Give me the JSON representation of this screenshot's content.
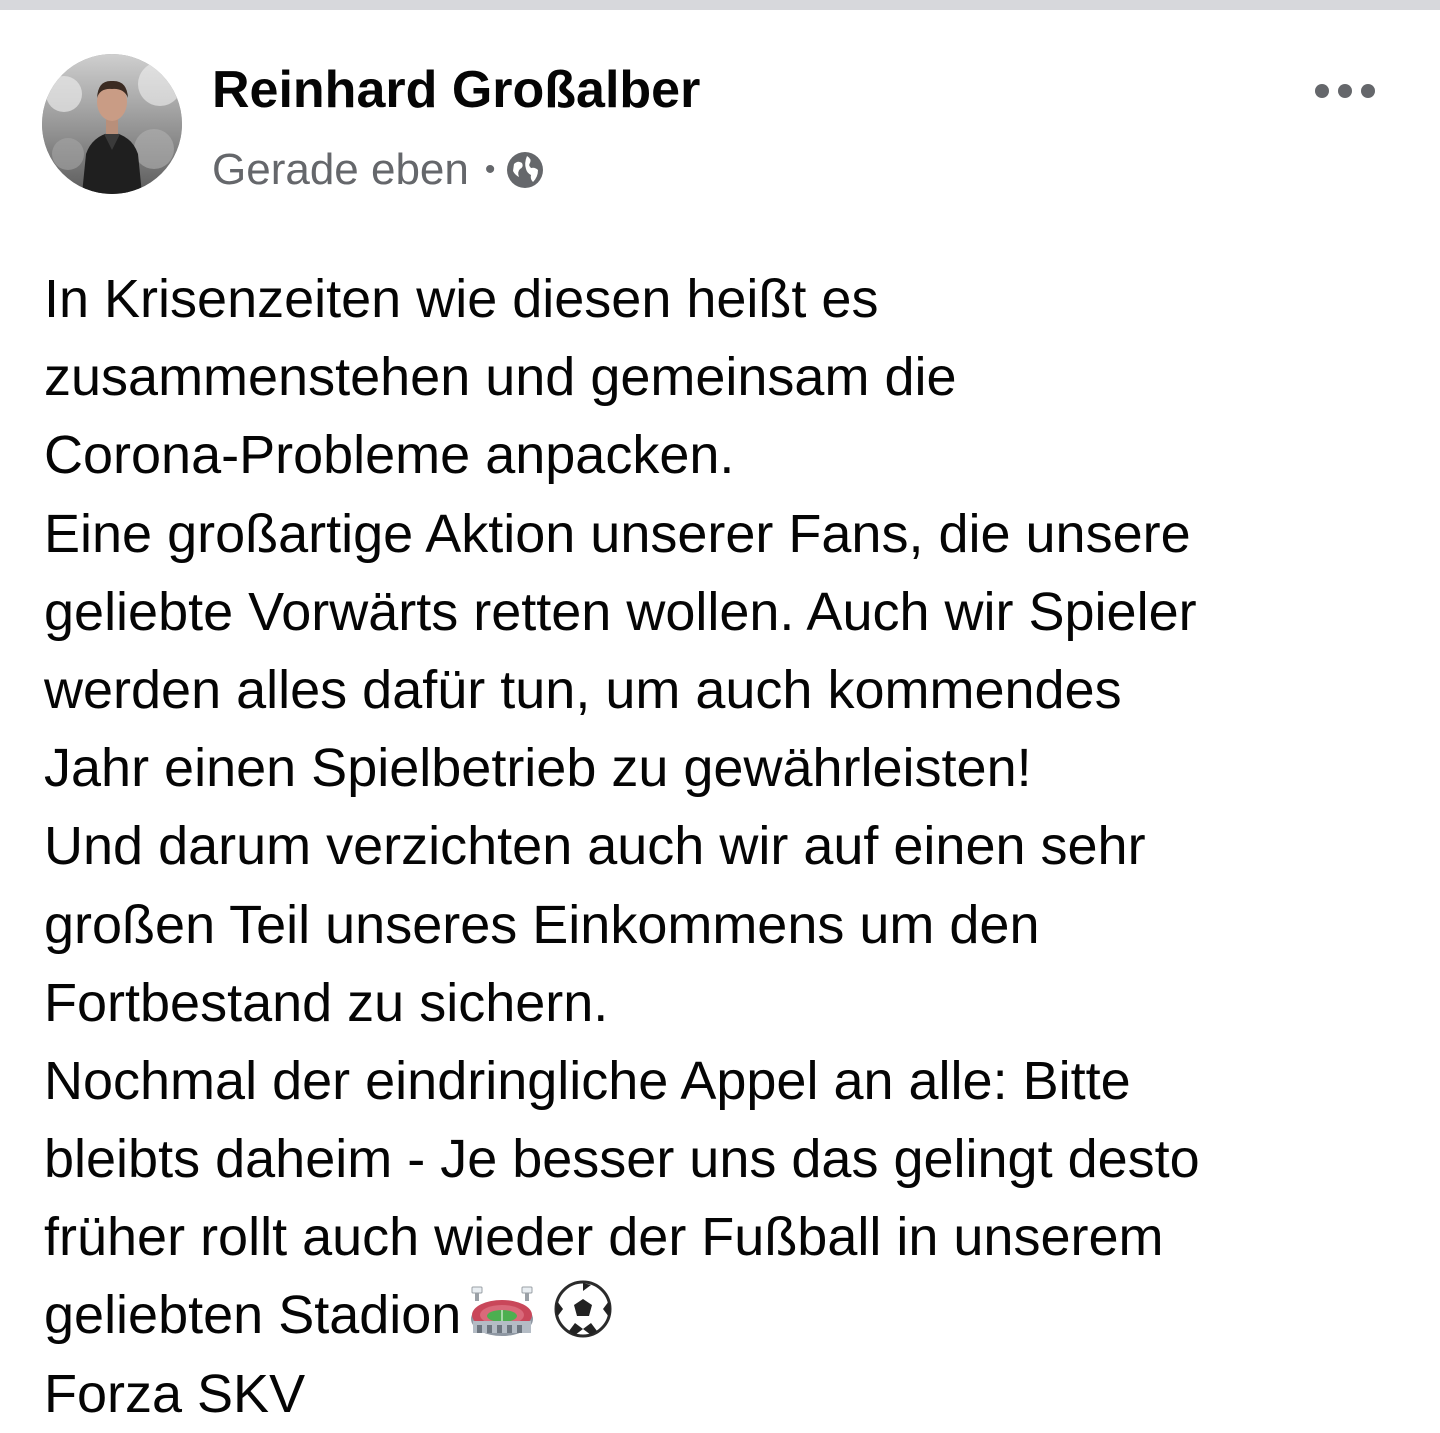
{
  "post": {
    "author": "Reinhard Großalber",
    "timestamp": "Gerade eben",
    "separator": "•",
    "privacy_icon": "globe-icon",
    "more_icon": "more-options-icon",
    "lines": [
      "In Krisenzeiten wie diesen heißt es",
      "zusammenstehen und gemeinsam die",
      "Corona-Probleme anpacken.",
      "Eine großartige Aktion unserer Fans, die unsere",
      "geliebte Vorwärts retten wollen. Auch wir Spieler",
      "werden alles dafür tun, um auch kommendes",
      "Jahr einen Spielbetrieb zu gewährleisten!",
      "Und darum verzichten auch wir auf einen sehr",
      "großen Teil unseres Einkommens um den",
      "Fortbestand zu sichern.",
      "Nochmal der eindringliche Appel an alle: Bitte",
      "bleibts daheim - Je besser uns das gelingt desto",
      "früher rollt auch wieder der Fußball in unserem",
      "geliebten Stadion",
      "Forza SKV"
    ],
    "emojis": [
      "stadium-emoji",
      "soccer-ball-emoji"
    ]
  },
  "colors": {
    "text": "#050505",
    "meta": "#65676b",
    "top_strip": "#d7d8dc"
  }
}
